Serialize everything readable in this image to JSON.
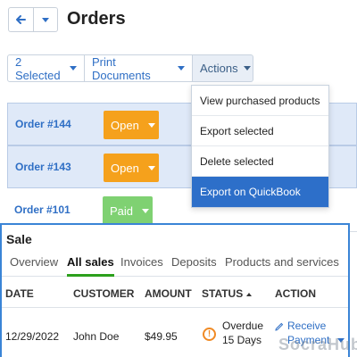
{
  "header": {
    "title": "Orders"
  },
  "toolbar": {
    "selected_label": "2 Selected",
    "print_label": "Print Documents",
    "actions_label": "Actions"
  },
  "orders": [
    {
      "id": "Order #144",
      "status": "Open",
      "selected": true
    },
    {
      "id": "Order #143",
      "status": "Open",
      "selected": true
    },
    {
      "id": "Order #101",
      "status": "Paid",
      "selected": false
    }
  ],
  "actions_menu": [
    "View purchased products",
    "Export selected",
    "Delete selected",
    "Export on QuickBook"
  ],
  "sale_panel": {
    "title": "Sale",
    "tabs": [
      "Overview",
      "All sales",
      "Invoices",
      "Deposits",
      "Products and services"
    ],
    "active_tab": "All sales",
    "columns": [
      "DATE",
      "CUSTOMER",
      "AMOUNT",
      "STATUS",
      "ACTION"
    ],
    "row": {
      "date": "12/29/2022",
      "customer": "John Doe",
      "amount": "$49.95",
      "status_line1": "Overdue",
      "status_line2": "15 Days",
      "action_line1": "Receive",
      "action_line2": "Payment"
    }
  },
  "watermark": "SocraHub",
  "colors": {
    "accent": "#2f6fc5",
    "open": "#f5a11c",
    "paid": "#7fd172",
    "highlight": "#2d6fc9",
    "tab_active": "#2ca01c",
    "panel_border": "#3a84d6"
  }
}
